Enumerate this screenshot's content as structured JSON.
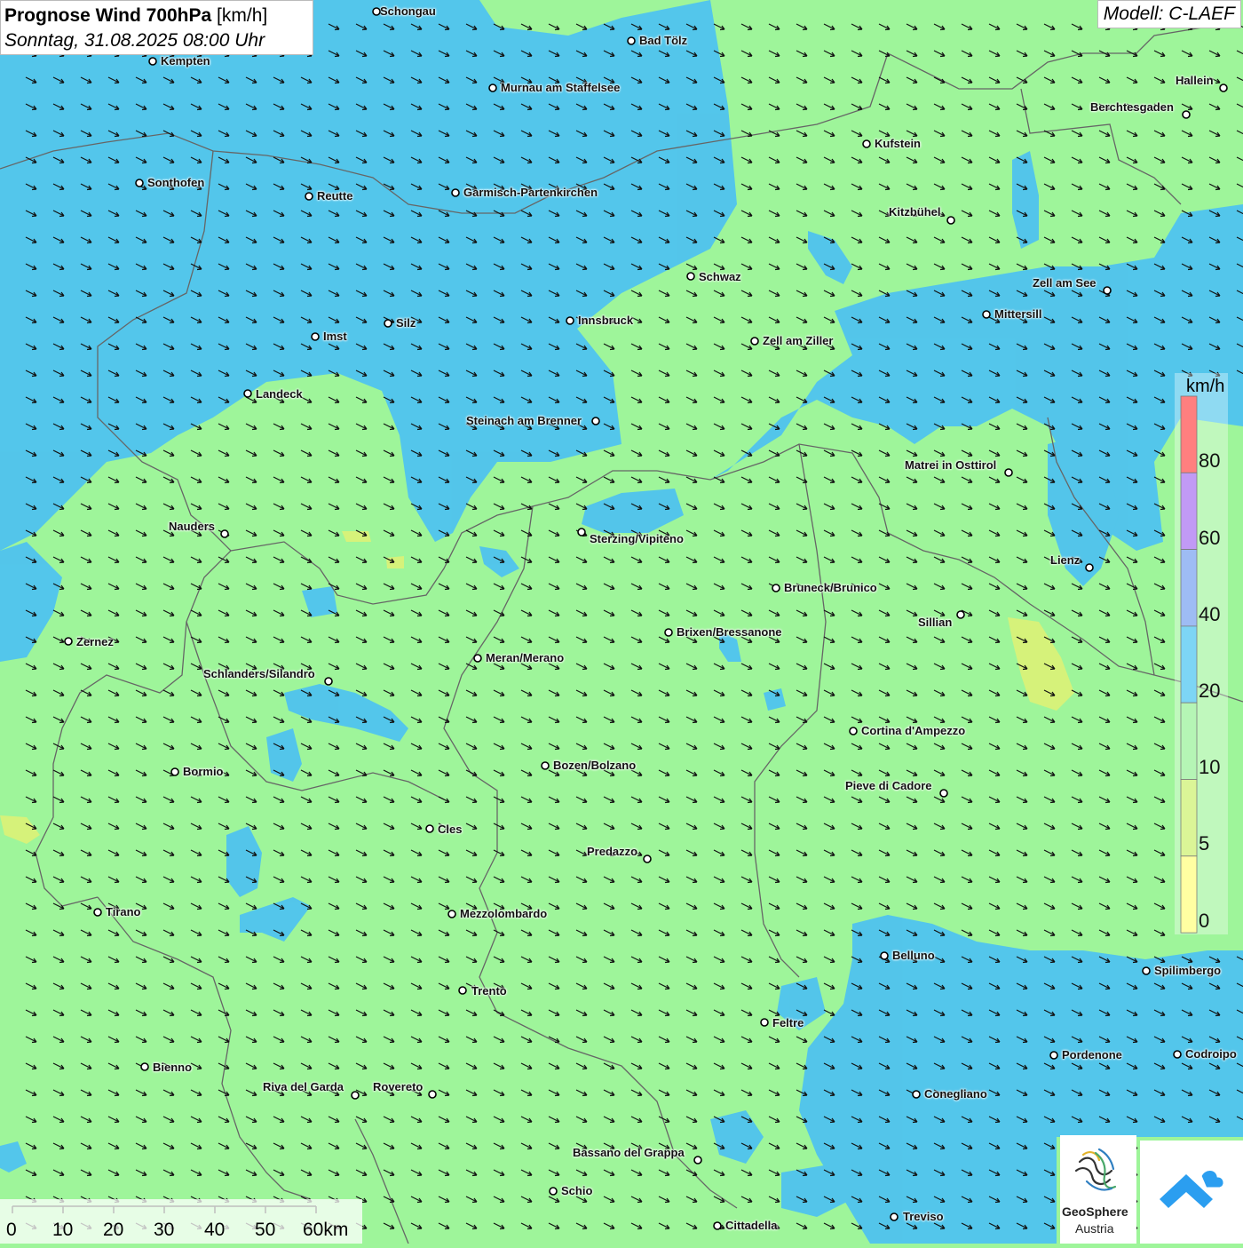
{
  "title": {
    "main": "Prognose Wind 700hPa",
    "unit": "[km/h]",
    "date": "Sonntag, 31.08.2025 08:00 Uhr"
  },
  "model": "Modell: C-LAEF",
  "legend": {
    "unit": "km/h",
    "labels": [
      "80",
      "60",
      "40",
      "20",
      "10",
      "5",
      "0"
    ],
    "colors": [
      "#ff3b3b",
      "#a064f0",
      "#6a98ee",
      "#38bff0",
      "#8ef08e",
      "#c8f060",
      "#ffff70"
    ]
  },
  "scale": {
    "labels": [
      "0",
      "10",
      "20",
      "30",
      "40",
      "50",
      "60km"
    ]
  },
  "cities": [
    {
      "name": "Schongau"
    },
    {
      "name": "Bad Tölz"
    },
    {
      "name": "Kempten"
    },
    {
      "name": "Murnau am Staffelsee"
    },
    {
      "name": "Hallein"
    },
    {
      "name": "Berchtesgaden"
    },
    {
      "name": "Kufstein"
    },
    {
      "name": "Sonthofen"
    },
    {
      "name": "Reutte"
    },
    {
      "name": "Garmisch-Partenkirchen"
    },
    {
      "name": "Kitzbühel"
    },
    {
      "name": "Schwaz"
    },
    {
      "name": "Zell am See"
    },
    {
      "name": "Mittersill"
    },
    {
      "name": "Innsbruck"
    },
    {
      "name": "Silz"
    },
    {
      "name": "Imst"
    },
    {
      "name": "Zell am Ziller"
    },
    {
      "name": "Landeck"
    },
    {
      "name": "Steinach am Brenner"
    },
    {
      "name": "Matrei in Osttirol"
    },
    {
      "name": "Nauders"
    },
    {
      "name": "Sterzing/Vipiteno"
    },
    {
      "name": "Lienz"
    },
    {
      "name": "Bruneck/Brunico"
    },
    {
      "name": "Sillian"
    },
    {
      "name": "Brixen/Bressanone"
    },
    {
      "name": "Zernez"
    },
    {
      "name": "Meran/Merano"
    },
    {
      "name": "Schlanders/Silandro"
    },
    {
      "name": "Cortina d'Ampezzo"
    },
    {
      "name": "Bozen/Bolzano"
    },
    {
      "name": "Bormio"
    },
    {
      "name": "Pieve di Cadore"
    },
    {
      "name": "Cles"
    },
    {
      "name": "Predazzo"
    },
    {
      "name": "Tirano"
    },
    {
      "name": "Mezzolombardo"
    },
    {
      "name": "Belluno"
    },
    {
      "name": "Spilimbergo"
    },
    {
      "name": "Trento"
    },
    {
      "name": "Feltre"
    },
    {
      "name": "Bienno"
    },
    {
      "name": "Pordenone"
    },
    {
      "name": "Codroipo"
    },
    {
      "name": "Riva del Garda"
    },
    {
      "name": "Rovereto"
    },
    {
      "name": "Conegliano"
    },
    {
      "name": "Bassano del Grappa"
    },
    {
      "name": "Schio"
    },
    {
      "name": "Treviso"
    },
    {
      "name": "Cittadella"
    }
  ],
  "logo": {
    "line1": "GeoSphere",
    "line2": "Austria"
  }
}
